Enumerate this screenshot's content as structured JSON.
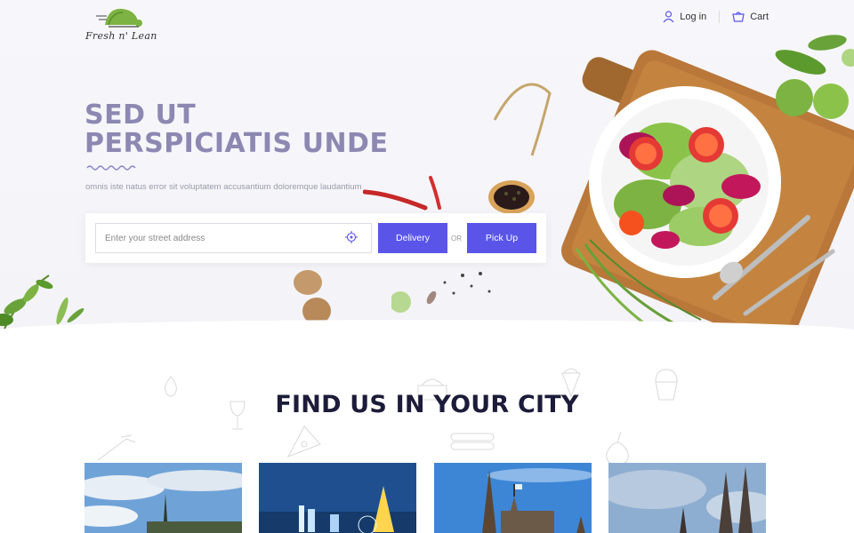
{
  "header": {
    "logo_text": "Fresh n' Lean",
    "login_label": "Log in",
    "cart_label": "Cart"
  },
  "hero": {
    "title_line1": "SED UT",
    "title_line2": "PERSPICIATIS UNDE",
    "subtitle": "omnis iste natus error sit voluptatem accusantium doloremque laudantium",
    "search": {
      "placeholder": "Enter your street address",
      "value": "",
      "delivery_label": "Delivery",
      "or_label": "OR",
      "pickup_label": "Pick Up"
    }
  },
  "cities": {
    "title": "FIND US IN YOUR CITY"
  },
  "colors": {
    "accent": "#5a55e8",
    "headline": "#8c88b2",
    "section_title": "#1c1c3a"
  },
  "icons": [
    "logo-turtle-icon",
    "user-icon",
    "cart-icon",
    "location-target-icon",
    "squiggle-divider-icon"
  ]
}
